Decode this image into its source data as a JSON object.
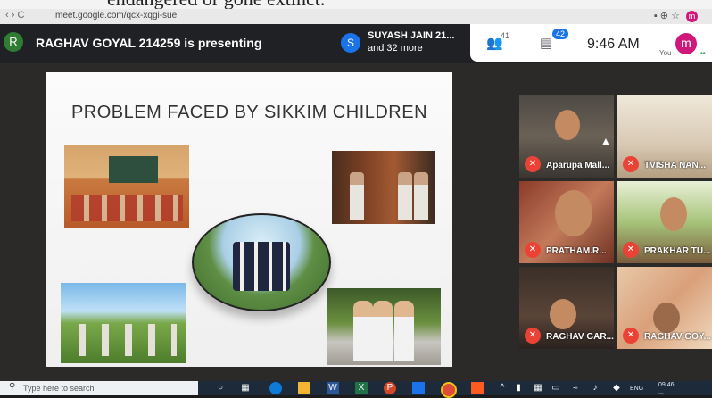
{
  "browser": {
    "doc_text": "endangered or gone extinct.",
    "url": "meet.google.com/qcx-xqgi-sue",
    "nav_glyphs": "‹ › C",
    "right_icons": "▪ ⊕ ☆",
    "profile_letter": "m"
  },
  "meet": {
    "presenter_initial": "R",
    "presenting_text": "RAGHAV GOYAL 214259 is presenting",
    "participant_initial": "S",
    "participant_name": "SUYASH JAIN 21...",
    "participant_more": "and 32 more",
    "people_count": "41",
    "chat_count": "42",
    "time": "9:46 AM",
    "you_initial": "m",
    "you_label": "You"
  },
  "slide": {
    "title": "PROBLEM FACED BY SIKKIM CHILDREN"
  },
  "tiles": [
    {
      "name": "Aparupa Mall..."
    },
    {
      "name": "TVISHA NAN..."
    },
    {
      "name": "PRATHAM.R..."
    },
    {
      "name": "PRAKHAR TU..."
    },
    {
      "name": "RAGHAV GAR..."
    },
    {
      "name": "RAGHAV GOY..."
    }
  ],
  "taskbar": {
    "search_placeholder": "Type here to search",
    "lang": "ENG",
    "time": "09:46",
    "date": "..."
  },
  "colors": {
    "meet_bar": "#202124",
    "mute_red": "#ea4335",
    "accent_blue": "#1a73e8",
    "presenter_green": "#2e7d32",
    "you_pink": "#d0187a"
  }
}
